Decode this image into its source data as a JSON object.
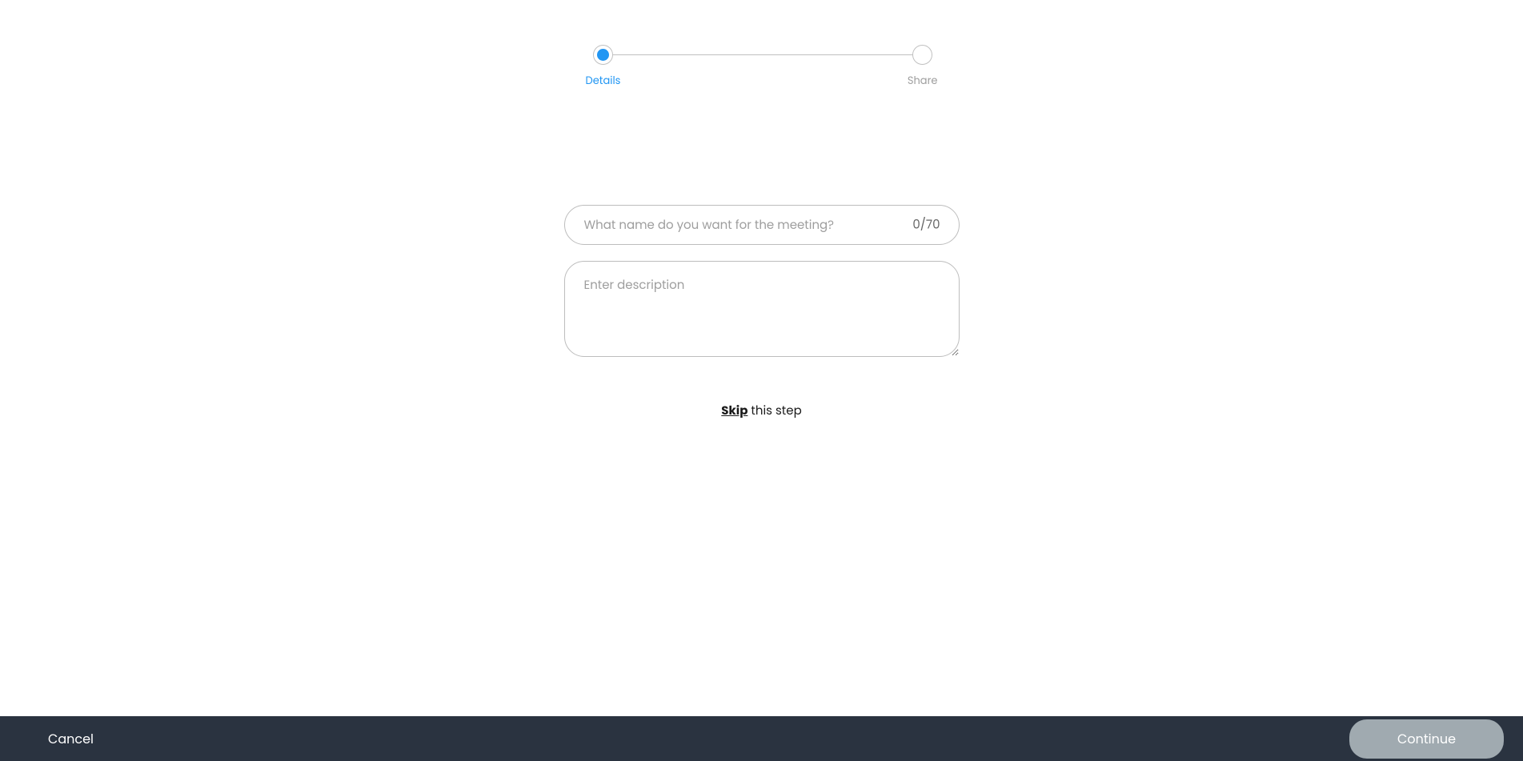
{
  "stepper": {
    "steps": [
      {
        "label": "Details",
        "active": true
      },
      {
        "label": "Share",
        "active": false
      }
    ]
  },
  "form": {
    "name_placeholder": "What name do you want for the meeting?",
    "name_value": "",
    "char_counter": "0/70",
    "description_placeholder": "Enter description",
    "description_value": ""
  },
  "skip": {
    "bold": "Skip",
    "rest": " this step"
  },
  "footer": {
    "cancel_label": "Cancel",
    "continue_label": "Continue"
  }
}
